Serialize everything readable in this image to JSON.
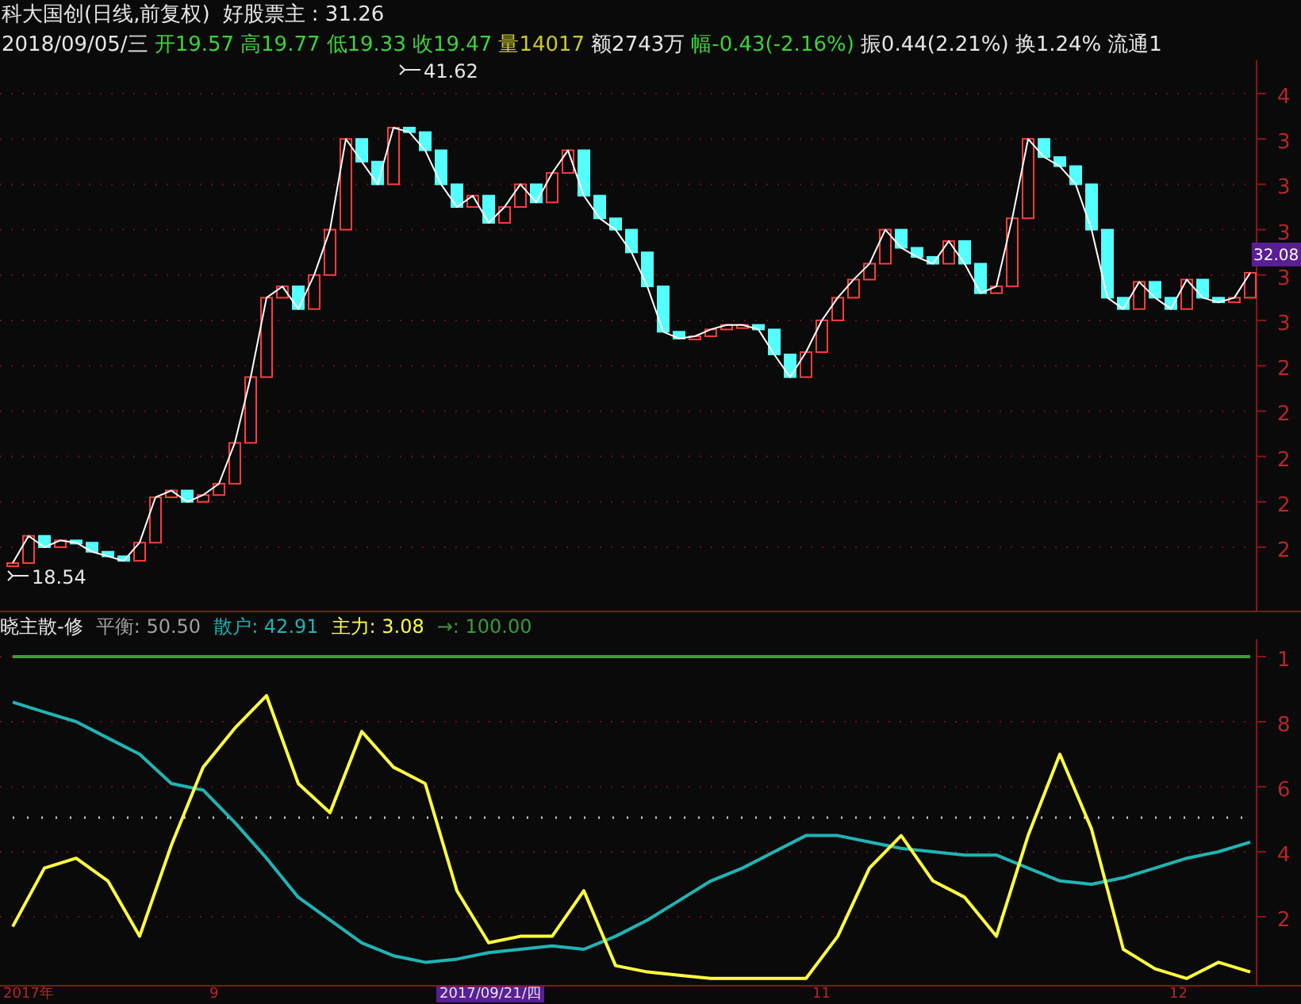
{
  "header": {
    "title": "科大国创(日线,前复权)",
    "indicator": "好股票主 : 31.26"
  },
  "quote": [
    {
      "text": "2018/09/05/三",
      "color": "#e6e6e6"
    },
    {
      "text": "开19.57",
      "color": "#3cd23c"
    },
    {
      "text": "高19.77",
      "color": "#3cd23c"
    },
    {
      "text": "低19.33",
      "color": "#3cd23c"
    },
    {
      "text": "收19.47",
      "color": "#3cd23c"
    },
    {
      "text": "量14017",
      "color": "#c8c832"
    },
    {
      "text": "额2743万",
      "color": "#e6e6e6"
    },
    {
      "text": "幅-0.43(-2.16%)",
      "color": "#3cd23c"
    },
    {
      "text": "振0.44(2.21%)",
      "color": "#e6e6e6"
    },
    {
      "text": "换1.24%",
      "color": "#e6e6e6"
    },
    {
      "text": "流通1",
      "color": "#e6e6e6"
    }
  ],
  "price_panel": {
    "axis_labels": [
      "4",
      "3",
      "3",
      "3",
      "3",
      "3",
      "2",
      "2",
      "2",
      "2",
      "2"
    ],
    "markers": [
      {
        "text": "41.62"
      },
      {
        "text": "18.54"
      }
    ],
    "price_tag": {
      "text": "32.08"
    }
  },
  "indicator_legend": [
    {
      "text": "晓主散-修",
      "color": "#e6e6e6"
    },
    {
      "text": "平衡: 50.50",
      "color": "#a0a0a0"
    },
    {
      "text": "散户: 42.91",
      "color": "#20b4b4"
    },
    {
      "text": "主力: 3.08",
      "color": "#ffff40"
    },
    {
      "text": "→: 100.00",
      "color": "#3c9a3c"
    }
  ],
  "indicator_panel": {
    "axis_labels": [
      "1",
      "8",
      "6",
      "4",
      "2"
    ]
  },
  "date_axis": [
    {
      "label": "2017年",
      "selected": false
    },
    {
      "label": "9",
      "selected": false
    },
    {
      "label": "2017/09/21/四",
      "selected": true
    },
    {
      "label": "11",
      "selected": false
    },
    {
      "label": "12",
      "selected": false
    }
  ]
}
